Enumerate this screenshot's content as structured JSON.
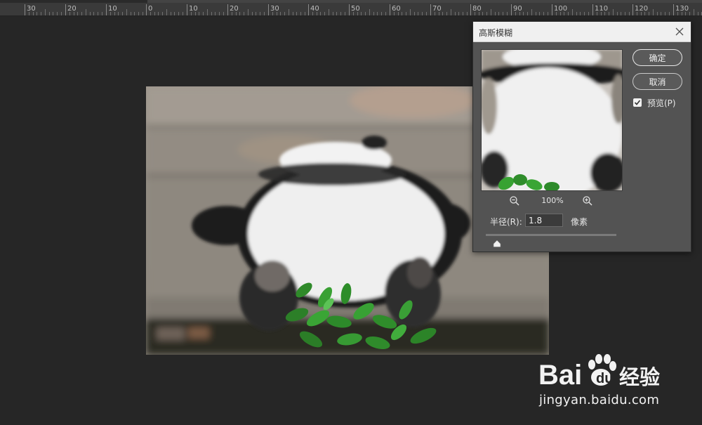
{
  "ruler": {
    "labels": [
      "30",
      "20",
      "10",
      "0",
      "10",
      "20",
      "30",
      "40",
      "50",
      "60",
      "70",
      "80",
      "90",
      "100",
      "110",
      "120",
      "130"
    ]
  },
  "dialog": {
    "title": "高斯模糊",
    "ok_label": "确定",
    "cancel_label": "取消",
    "preview_label": "预览(P)",
    "preview_checked": true,
    "zoom_level": "100%",
    "radius_label": "半径(R):",
    "radius_value": "1.8",
    "radius_unit": "像素"
  },
  "watermark": {
    "logo_text": "Bai",
    "logo_suffix": "经验",
    "url": "jingyan.baidu.com"
  },
  "colors": {
    "workspace_bg": "#262626",
    "dialog_bg": "#535353",
    "titlebar_bg": "#f0f0f0"
  }
}
